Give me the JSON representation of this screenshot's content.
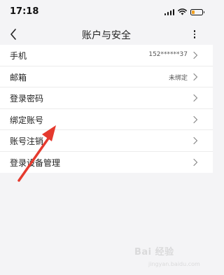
{
  "status_bar": {
    "time": "17:18",
    "battery_level": 0.3,
    "battery_color": "#f0a020"
  },
  "nav": {
    "title": "账户与安全",
    "back_icon": "chevron-left-icon",
    "more_icon": "more-vertical-icon"
  },
  "settings": {
    "items": [
      {
        "label": "手机",
        "value": "152******37"
      },
      {
        "label": "邮箱",
        "value": "未绑定"
      },
      {
        "label": "登录密码",
        "value": ""
      },
      {
        "label": "绑定账号",
        "value": ""
      },
      {
        "label": "账号注销",
        "value": ""
      },
      {
        "label": "登录设备管理",
        "value": ""
      }
    ]
  },
  "overlay": {
    "arrow_color": "#e53a2e"
  },
  "watermark": {
    "brand": "Bai 经验",
    "url": "jingyan.baidu.com"
  }
}
